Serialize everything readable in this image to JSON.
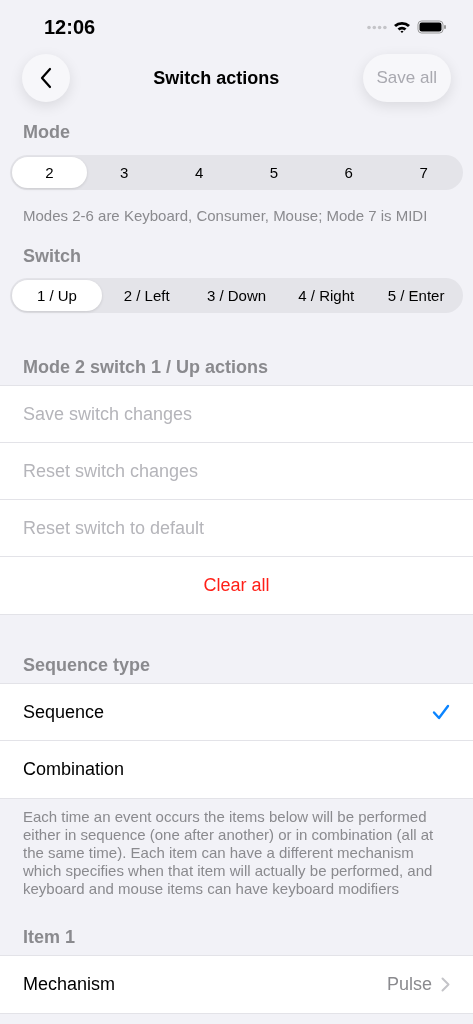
{
  "status_bar": {
    "time": "12:06"
  },
  "nav": {
    "title": "Switch actions",
    "save_button": {
      "label": "Save all",
      "disabled": true
    }
  },
  "mode_section": {
    "header": "Mode",
    "segments": [
      {
        "label": "2",
        "selected": true
      },
      {
        "label": "3",
        "selected": false
      },
      {
        "label": "4",
        "selected": false
      },
      {
        "label": "5",
        "selected": false
      },
      {
        "label": "6",
        "selected": false
      },
      {
        "label": "7",
        "selected": false
      }
    ],
    "footer": "Modes 2-6 are Keyboard, Consumer, Mouse; Mode 7 is MIDI"
  },
  "switch_section": {
    "header": "Switch",
    "segments": [
      {
        "label": "1 / Up",
        "selected": true
      },
      {
        "label": "2 / Left",
        "selected": false
      },
      {
        "label": "3 / Down",
        "selected": false
      },
      {
        "label": "4 / Right",
        "selected": false
      },
      {
        "label": "5 / Enter",
        "selected": false
      }
    ]
  },
  "actions_section": {
    "header": "Mode 2 switch 1 / Up actions",
    "rows": [
      {
        "label": "Save switch changes",
        "kind": "action",
        "disabled": true
      },
      {
        "label": "Reset switch changes",
        "kind": "action",
        "disabled": true
      },
      {
        "label": "Reset switch to default",
        "kind": "action",
        "disabled": true
      },
      {
        "label": "Clear all",
        "kind": "destructive",
        "disabled": false
      }
    ]
  },
  "sequence_section": {
    "header": "Sequence type",
    "options": [
      {
        "label": "Sequence",
        "selected": true
      },
      {
        "label": "Combination",
        "selected": false
      }
    ],
    "footer": "Each time an event occurs the items below will be performed either in sequence (one after another) or in combination (all at the same time). Each item can have a different mechanism which specifies when that item will actually be performed, and keyboard and mouse items can have keyboard modifiers"
  },
  "item_section": {
    "header": "Item 1",
    "rows": [
      {
        "label": "Mechanism",
        "value": "Pulse"
      }
    ]
  }
}
